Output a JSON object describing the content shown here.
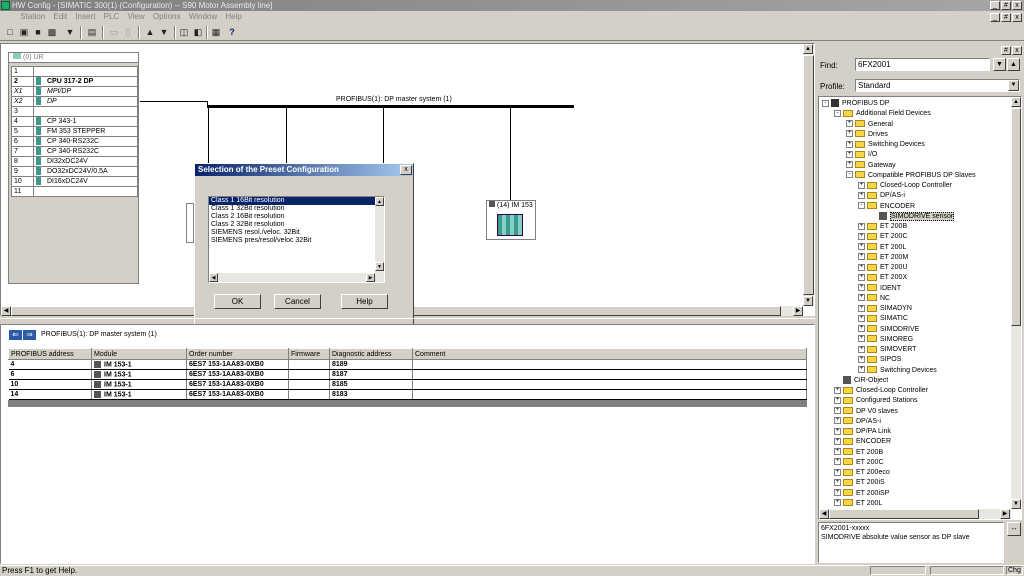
{
  "window": {
    "title": "HW Config - [SIMATIC 300(1) (Configuration) -- S90 Motor Assembly line]",
    "controls": [
      "_",
      "#",
      "x"
    ]
  },
  "menu": [
    "Station",
    "Edit",
    "Insert",
    "PLC",
    "View",
    "Options",
    "Window",
    "Help"
  ],
  "rack": {
    "title": "(0) UR",
    "rows": [
      {
        "slot": "1",
        "module": ""
      },
      {
        "slot": "2",
        "module": "CPU 317-2 DP"
      },
      {
        "slot": "X1",
        "module": "MPI/DP"
      },
      {
        "slot": "X2",
        "module": "DP"
      },
      {
        "slot": "3",
        "module": ""
      },
      {
        "slot": "4",
        "module": "CP 343-1"
      },
      {
        "slot": "5",
        "module": "FM 353 STEPPER"
      },
      {
        "slot": "6",
        "module": "CP 340-RS232C"
      },
      {
        "slot": "7",
        "module": "CP 340-RS232C"
      },
      {
        "slot": "8",
        "module": "DI32xDC24V"
      },
      {
        "slot": "9",
        "module": "DO32xDC24V/0.5A"
      },
      {
        "slot": "10",
        "module": "DI16xDC24V"
      },
      {
        "slot": "11",
        "module": ""
      }
    ]
  },
  "network": {
    "label": "PROFIBUS(1): DP master system (1)",
    "slave_label": "(14) IM 153"
  },
  "dialog": {
    "title": "Selection of the Preset Configuration",
    "close": "x",
    "options": [
      "Class 1  16Bit resolution",
      "Class 1  32Bit resolution",
      "Class 2  16Bit resolution",
      "Class 2  32Bit resolution",
      "SIEMENS resol./veloc. 32Bit",
      "SIEMENS pres/resol/veloc 32Bit"
    ],
    "ok": "OK",
    "cancel": "Cancel",
    "help": "Help"
  },
  "detail": {
    "header": "PROFIBUS(1): DP master system (1)",
    "columns": [
      "PROFIBUS address",
      "Module",
      "Order number",
      "Firmware",
      "Diagnostic address",
      "Comment"
    ],
    "rows": [
      {
        "addr": "4",
        "module": "IM 153-1",
        "order": "6ES7 153-1AA83-0XB0",
        "fw": "",
        "diag": "8189",
        "comment": ""
      },
      {
        "addr": "6",
        "module": "IM 153-1",
        "order": "6ES7 153-1AA83-0XB0",
        "fw": "",
        "diag": "8187",
        "comment": ""
      },
      {
        "addr": "10",
        "module": "IM 153-1",
        "order": "6ES7 153-1AA83-0XB0",
        "fw": "",
        "diag": "8185",
        "comment": ""
      },
      {
        "addr": "14",
        "module": "IM 153-1",
        "order": "6ES7 153-1AA83-0XB0",
        "fw": "",
        "diag": "8183",
        "comment": ""
      }
    ]
  },
  "catalog": {
    "find_label": "Find:",
    "find_value": "6FX2001",
    "profile_label": "Profile:",
    "profile_value": "Standard",
    "tree": [
      {
        "label": "PROFIBUS DP",
        "level": 0,
        "exp": "-",
        "icon": "bus"
      },
      {
        "label": "Additional Field Devices",
        "level": 1,
        "exp": "-",
        "icon": "folder"
      },
      {
        "label": "General",
        "level": 2,
        "exp": "+",
        "icon": "folder"
      },
      {
        "label": "Drives",
        "level": 2,
        "exp": "+",
        "icon": "folder"
      },
      {
        "label": "Switching Devices",
        "level": 2,
        "exp": "+",
        "icon": "folder"
      },
      {
        "label": "I/O",
        "level": 2,
        "exp": "+",
        "icon": "folder"
      },
      {
        "label": "Gateway",
        "level": 2,
        "exp": "+",
        "icon": "folder"
      },
      {
        "label": "Compatible PROFIBUS DP Slaves",
        "level": 2,
        "exp": "-",
        "icon": "folder"
      },
      {
        "label": "Closed-Loop Controller",
        "level": 3,
        "exp": "+",
        "icon": "folder"
      },
      {
        "label": "DP/AS-i",
        "level": 3,
        "exp": "+",
        "icon": "folder"
      },
      {
        "label": "ENCODER",
        "level": 3,
        "exp": "-",
        "icon": "folder"
      },
      {
        "label": "SIMODRIVE sensor",
        "level": 4,
        "exp": "",
        "icon": "device",
        "selected": true
      },
      {
        "label": "ET 200B",
        "level": 3,
        "exp": "+",
        "icon": "folder"
      },
      {
        "label": "ET 200C",
        "level": 3,
        "exp": "+",
        "icon": "folder"
      },
      {
        "label": "ET 200L",
        "level": 3,
        "exp": "+",
        "icon": "folder"
      },
      {
        "label": "ET 200M",
        "level": 3,
        "exp": "+",
        "icon": "folder"
      },
      {
        "label": "ET 200U",
        "level": 3,
        "exp": "+",
        "icon": "folder"
      },
      {
        "label": "ET 200X",
        "level": 3,
        "exp": "+",
        "icon": "folder"
      },
      {
        "label": "IDENT",
        "level": 3,
        "exp": "+",
        "icon": "folder"
      },
      {
        "label": "NC",
        "level": 3,
        "exp": "+",
        "icon": "folder"
      },
      {
        "label": "SIMADYN",
        "level": 3,
        "exp": "+",
        "icon": "folder"
      },
      {
        "label": "SIMATIC",
        "level": 3,
        "exp": "+",
        "icon": "folder"
      },
      {
        "label": "SIMODRIVE",
        "level": 3,
        "exp": "+",
        "icon": "folder"
      },
      {
        "label": "SIMOREG",
        "level": 3,
        "exp": "+",
        "icon": "folder"
      },
      {
        "label": "SIMOVERT",
        "level": 3,
        "exp": "+",
        "icon": "folder"
      },
      {
        "label": "SIPOS",
        "level": 3,
        "exp": "+",
        "icon": "folder"
      },
      {
        "label": "Switching Devices",
        "level": 3,
        "exp": "+",
        "icon": "folder"
      },
      {
        "label": "CiR-Object",
        "level": 1,
        "exp": "",
        "icon": "device"
      },
      {
        "label": "Closed-Loop Controller",
        "level": 1,
        "exp": "+",
        "icon": "folder"
      },
      {
        "label": "Configured Stations",
        "level": 1,
        "exp": "+",
        "icon": "folder"
      },
      {
        "label": "DP V0 slaves",
        "level": 1,
        "exp": "+",
        "icon": "folder"
      },
      {
        "label": "DP/AS-i",
        "level": 1,
        "exp": "+",
        "icon": "folder"
      },
      {
        "label": "DP/PA Link",
        "level": 1,
        "exp": "+",
        "icon": "folder"
      },
      {
        "label": "ENCODER",
        "level": 1,
        "exp": "+",
        "icon": "folder"
      },
      {
        "label": "ET 200B",
        "level": 1,
        "exp": "+",
        "icon": "folder"
      },
      {
        "label": "ET 200C",
        "level": 1,
        "exp": "+",
        "icon": "folder"
      },
      {
        "label": "ET 200eco",
        "level": 1,
        "exp": "+",
        "icon": "folder"
      },
      {
        "label": "ET 200iS",
        "level": 1,
        "exp": "+",
        "icon": "folder"
      },
      {
        "label": "ET 200iSP",
        "level": 1,
        "exp": "+",
        "icon": "folder"
      },
      {
        "label": "ET 200L",
        "level": 1,
        "exp": "+",
        "icon": "folder"
      }
    ],
    "info_line1": "6FX2001-xxxxx",
    "info_line2": "SIMODRIVE absolute value sensor as DP slave"
  },
  "status": {
    "text": "Press F1 to get Help.",
    "right": "Chg"
  }
}
